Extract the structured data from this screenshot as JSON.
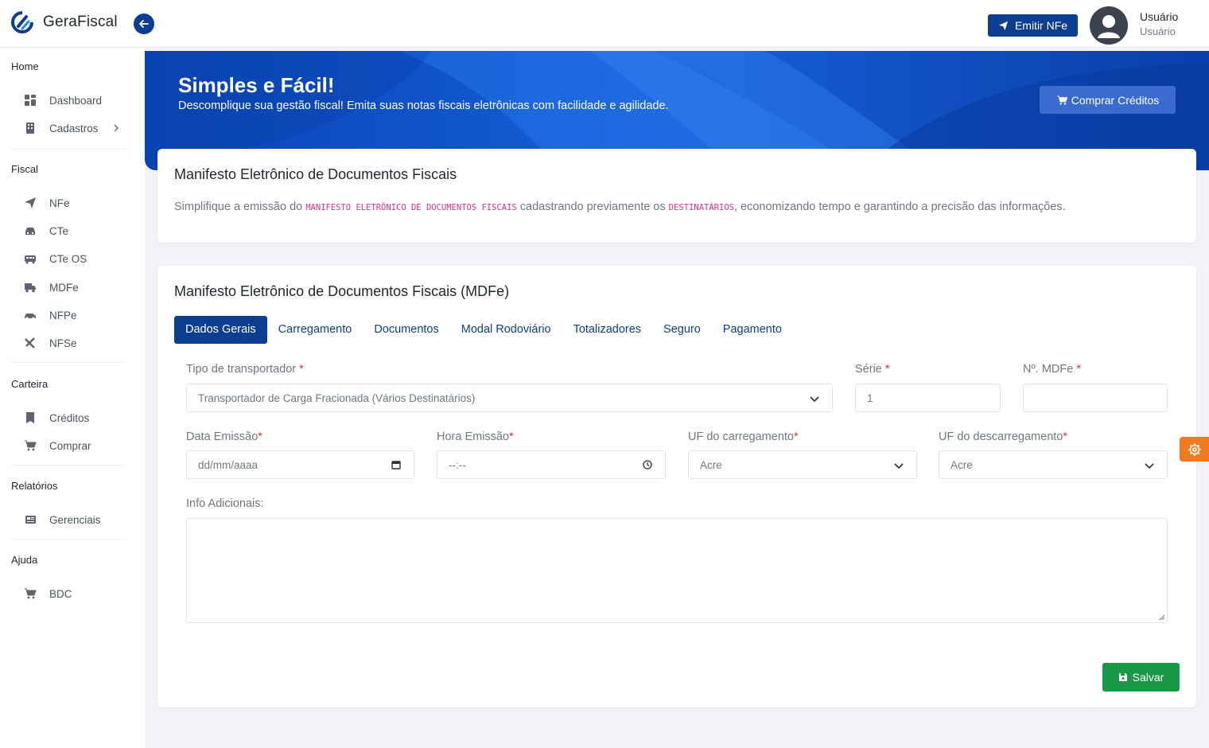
{
  "brand": {
    "name": "GeraFiscal"
  },
  "header": {
    "emit_button": "Emitir NFe",
    "user_name": "Usuário",
    "user_role": "Usuário"
  },
  "sidebar": {
    "sections": [
      {
        "title": "Home",
        "items": [
          "Dashboard",
          "Cadastros"
        ]
      },
      {
        "title": "Fiscal",
        "items": [
          "NFe",
          "CTe",
          "CTe OS",
          "MDFe",
          "NFPe",
          "NFSe"
        ]
      },
      {
        "title": "Carteira",
        "items": [
          "Créditos",
          "Comprar"
        ]
      },
      {
        "title": "Relatórios",
        "items": [
          "Gerenciais"
        ]
      },
      {
        "title": "Ajuda",
        "items": [
          "BDC"
        ]
      }
    ]
  },
  "hero": {
    "title": "Simples e Fácil!",
    "subtitle": "Descomplique sua gestão fiscal! Emita suas notas fiscais eletrônicas com facilidade e agilidade.",
    "buy_button": "Comprar Créditos"
  },
  "info_card": {
    "title": "Manifesto Eletrônico de Documentos Fiscais",
    "text_1": "Simplifique a emissão do ",
    "code_1": "MANIFESTO ELETRÔNICO DE DOCUMENTOS FISCAIS",
    "text_2": " cadastrando previamente os ",
    "code_2": "DESTINATÁRIOS",
    "text_3": ", economizando tempo e garantindo a precisão das informações."
  },
  "form_card": {
    "title": "Manifesto Eletrônico de Documentos Fiscais (MDFe)",
    "tabs": [
      "Dados Gerais",
      "Carregamento",
      "Documentos",
      "Modal Rodoviário",
      "Totalizadores",
      "Seguro",
      "Pagamento"
    ],
    "active_tab": "Dados Gerais",
    "fields": {
      "tipo_label": "Tipo de transportador",
      "tipo_value": "Transportador de Carga Fracionada (Vários Destinatários)",
      "serie_label": "Série",
      "serie_value": "1",
      "numero_label": "Nº. MDFe",
      "numero_value": "",
      "data_label": "Data Emissão",
      "data_placeholder": "dd/mm/aaaa",
      "hora_label": "Hora Emissão",
      "hora_placeholder": "--:--",
      "uf_carregamento_label": "UF do carregamento",
      "uf_carregamento_value": "Acre",
      "uf_descarregamento_label": "UF do descarregamento",
      "uf_descarregamento_value": "Acre",
      "info_label": "Info Adicionais:",
      "required_mark": "*"
    },
    "save_button": "Salvar"
  },
  "colors": {
    "primary": "#0b3e91",
    "hero": "#0b4bc4",
    "success": "#189947",
    "accent": "#f47a20",
    "code": "#d6338a"
  }
}
